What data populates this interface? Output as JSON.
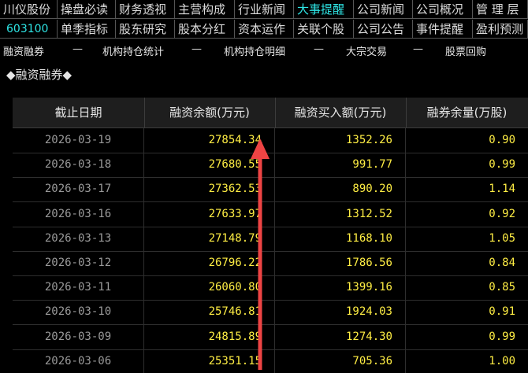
{
  "tabs_row1": [
    "川仪股份",
    "操盘必读",
    "财务透视",
    "主营构成",
    "行业新闻",
    "大事提醒",
    "公司新闻",
    "公司概况",
    "管 理 层"
  ],
  "tabs_row2": [
    "603100",
    "单季指标",
    "股东研究",
    "股本分红",
    "资本运作",
    "关联个股",
    "公司公告",
    "事件提醒",
    "盈利预测"
  ],
  "subnav": [
    "融资融券",
    "—",
    "机构持仓统计",
    "—",
    "机构持仓明细",
    "—",
    "大宗交易",
    "—",
    "股票回购"
  ],
  "section_title": "◆融资融券◆",
  "table": {
    "headers": [
      "截止日期",
      "融资余额(万元)",
      "融资买入额(万元)",
      "融券余量(万股)"
    ],
    "rows": [
      [
        "2026-03-19",
        "27854.34",
        "1352.26",
        "0.90"
      ],
      [
        "2026-03-18",
        "27680.55",
        "991.77",
        "0.99"
      ],
      [
        "2026-03-17",
        "27362.53",
        "890.20",
        "1.14"
      ],
      [
        "2026-03-16",
        "27633.97",
        "1312.52",
        "0.92"
      ],
      [
        "2026-03-13",
        "27148.79",
        "1168.10",
        "1.05"
      ],
      [
        "2026-03-12",
        "26796.22",
        "1786.56",
        "0.84"
      ],
      [
        "2026-03-11",
        "26060.80",
        "1399.16",
        "0.85"
      ],
      [
        "2026-03-10",
        "25746.81",
        "1924.03",
        "0.91"
      ],
      [
        "2026-03-09",
        "24815.89",
        "1274.30",
        "0.99"
      ],
      [
        "2026-03-06",
        "25351.15",
        "705.36",
        "1.00"
      ]
    ]
  },
  "colors": {
    "accent": "#2ee6e6",
    "value": "#ffee44",
    "arrow": "#ee4444"
  }
}
